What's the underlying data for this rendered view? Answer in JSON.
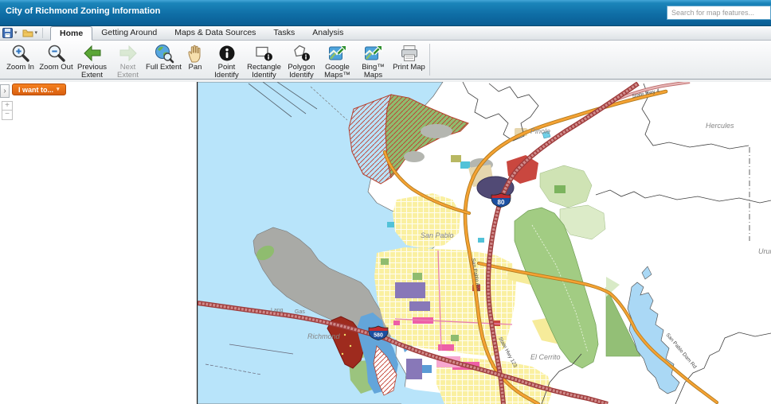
{
  "header": {
    "title": "City of Richmond Zoning Information",
    "search_placeholder": "Search for map features..."
  },
  "menu": {
    "tabs": [
      {
        "label": "Home",
        "active": true
      },
      {
        "label": "Getting Around",
        "active": false
      },
      {
        "label": "Maps & Data Sources",
        "active": false
      },
      {
        "label": "Tasks",
        "active": false
      },
      {
        "label": "Analysis",
        "active": false
      }
    ]
  },
  "toolbar": {
    "buttons": [
      {
        "label": "Zoom In",
        "icon": "zoom-in-icon",
        "enabled": true
      },
      {
        "label": "Zoom Out",
        "icon": "zoom-out-icon",
        "enabled": true
      },
      {
        "label": "Previous Extent",
        "icon": "previous-extent-icon",
        "enabled": true
      },
      {
        "label": "Next Extent",
        "icon": "next-extent-icon",
        "enabled": false
      },
      {
        "label": "Full Extent",
        "icon": "full-extent-icon",
        "enabled": true
      },
      {
        "label": "Pan",
        "icon": "pan-icon",
        "enabled": true
      },
      {
        "label": "Point Identify",
        "icon": "point-identify-icon",
        "enabled": true
      },
      {
        "label": "Rectangle Identify",
        "icon": "rectangle-identify-icon",
        "enabled": true
      },
      {
        "label": "Polygon Identify",
        "icon": "polygon-identify-icon",
        "enabled": true
      },
      {
        "label": "Google Maps™",
        "icon": "google-maps-icon",
        "enabled": true
      },
      {
        "label": "Bing™ Maps",
        "icon": "bing-maps-icon",
        "enabled": true
      },
      {
        "label": "Print Map",
        "icon": "print-map-icon",
        "enabled": true
      }
    ]
  },
  "overlay": {
    "i_want_to_label": "I want to...",
    "expander_glyph": "›",
    "caret_glyph": "▾",
    "zoom_in_glyph": "+",
    "zoom_out_glyph": "−"
  },
  "map": {
    "city_labels": [
      {
        "text": "San Pablo"
      },
      {
        "text": "Richmond"
      },
      {
        "text": "Pinole"
      },
      {
        "text": "Hercules"
      },
      {
        "text": "El Cerrito"
      },
      {
        "text": "Urun"
      }
    ],
    "road_labels": [
      {
        "text": "State Hwy 4"
      },
      {
        "text": "San Pablo Ave"
      },
      {
        "text": "State Hwy 123"
      },
      {
        "text": "San Pablo Dam Rd"
      }
    ],
    "minor_labels": [
      {
        "text": "Lang"
      },
      {
        "text": "Gas"
      }
    ],
    "shields": [
      {
        "route": "80"
      },
      {
        "route": "580"
      }
    ],
    "colors": {
      "water": "#b8e4fa",
      "harbor_water": "#63a5da",
      "freeway_red": "#9e3a3a",
      "highway_orange": "#f5a233",
      "state_hwy_pink": "#e7b7b7",
      "park_green": "#a2cc83",
      "residential_yellow": "#faf0a0",
      "industrial_gray": "#a9aaa6",
      "downtown_purple": "#8878b8",
      "accent_orange_button": "#f5811f",
      "header_blue": "#0f6ea6"
    }
  }
}
